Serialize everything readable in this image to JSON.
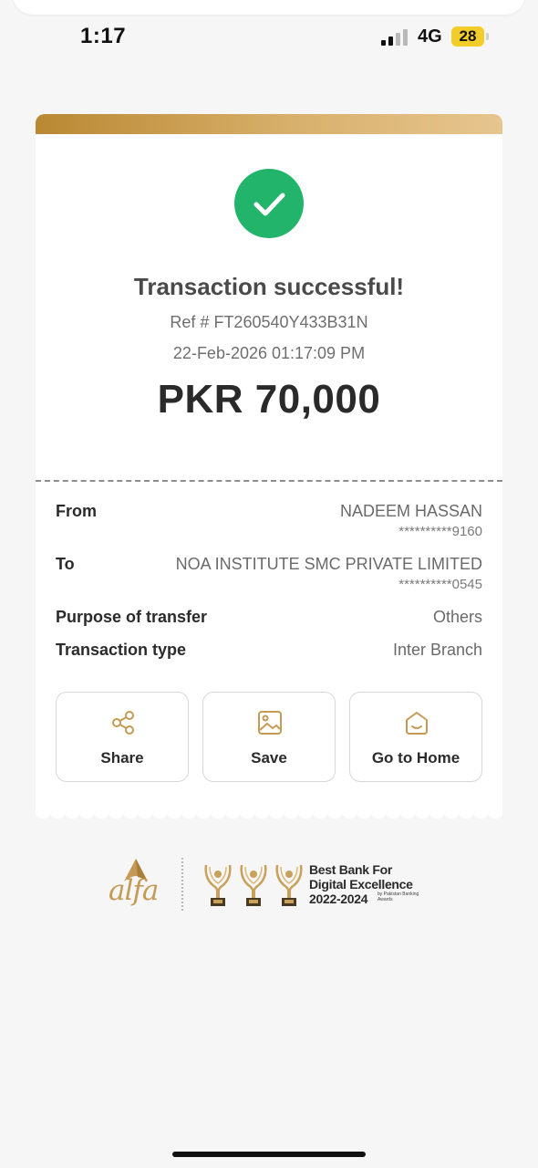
{
  "status_bar": {
    "time": "1:17",
    "network": "4G",
    "battery": "28",
    "battery_color": "#f2cd2a"
  },
  "receipt": {
    "title": "Transaction successful!",
    "reference": "Ref # FT260540Y433B31N",
    "datetime": "22-Feb-2026 01:17:09 PM",
    "amount": "PKR 70,000",
    "success_color": "#22b46a",
    "accent_color": "#c49a56",
    "details": [
      {
        "label": "From",
        "value": "NADEEM HASSAN",
        "sub": "**********9160"
      },
      {
        "label": "To",
        "value": "NOA INSTITUTE SMC PRIVATE LIMITED",
        "sub": "**********0545"
      },
      {
        "label": "Purpose of transfer",
        "value": "Others"
      },
      {
        "label": "Transaction type",
        "value": "Inter Branch"
      }
    ],
    "actions": [
      {
        "label": "Share",
        "icon": "share-icon"
      },
      {
        "label": "Save",
        "icon": "image-icon"
      },
      {
        "label": "Go to Home",
        "icon": "home-icon"
      }
    ]
  },
  "footer": {
    "logo_text": "alfa",
    "award_line1": "Best Bank For",
    "award_line2": "Digital Excellence",
    "award_years": "2022-2024",
    "award_by": "by Pakistan Banking Awards"
  }
}
